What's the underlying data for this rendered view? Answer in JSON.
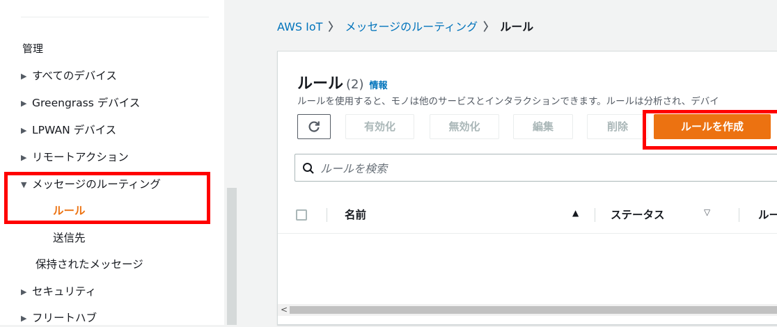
{
  "sidebar": {
    "heading": "管理",
    "items": [
      {
        "label": "すべてのデバイス"
      },
      {
        "label": "Greengrass デバイス"
      },
      {
        "label": "LPWAN デバイス"
      },
      {
        "label": "リモートアクション"
      },
      {
        "label": "メッセージのルーティング"
      }
    ],
    "sub_items": [
      {
        "label": "ルール"
      },
      {
        "label": "送信先"
      }
    ],
    "plain_item": "保持されたメッセージ",
    "items_after": [
      {
        "label": "セキュリティ"
      },
      {
        "label": "フリートハブ"
      }
    ],
    "collapsed_glyph": "▶",
    "expanded_glyph": "▼"
  },
  "breadcrumb": {
    "root": "AWS IoT",
    "middle": "メッセージのルーティング",
    "current": "ルール",
    "separator": "〉"
  },
  "panel": {
    "title": "ルール",
    "count": "(2)",
    "info": "情報",
    "description": "ルールを使用すると、モノは他のサービスとインタラクションできます。ルールは分析され、デバイ"
  },
  "toolbar": {
    "enable": "有効化",
    "disable": "無効化",
    "edit": "編集",
    "delete": "削除",
    "create": "ルールを作成"
  },
  "search": {
    "placeholder": "ルールを検索",
    "value": ""
  },
  "table": {
    "columns": [
      "名前",
      "ステータス",
      "ルー"
    ],
    "sort_asc_glyph": "▲",
    "sort_desc_glyph": "▽",
    "rows": []
  },
  "scrollbar": {
    "left_arrow": "<"
  },
  "colors": {
    "accent_orange": "#ec7211",
    "link_blue": "#0073bb",
    "highlight_red": "#ff0000"
  }
}
